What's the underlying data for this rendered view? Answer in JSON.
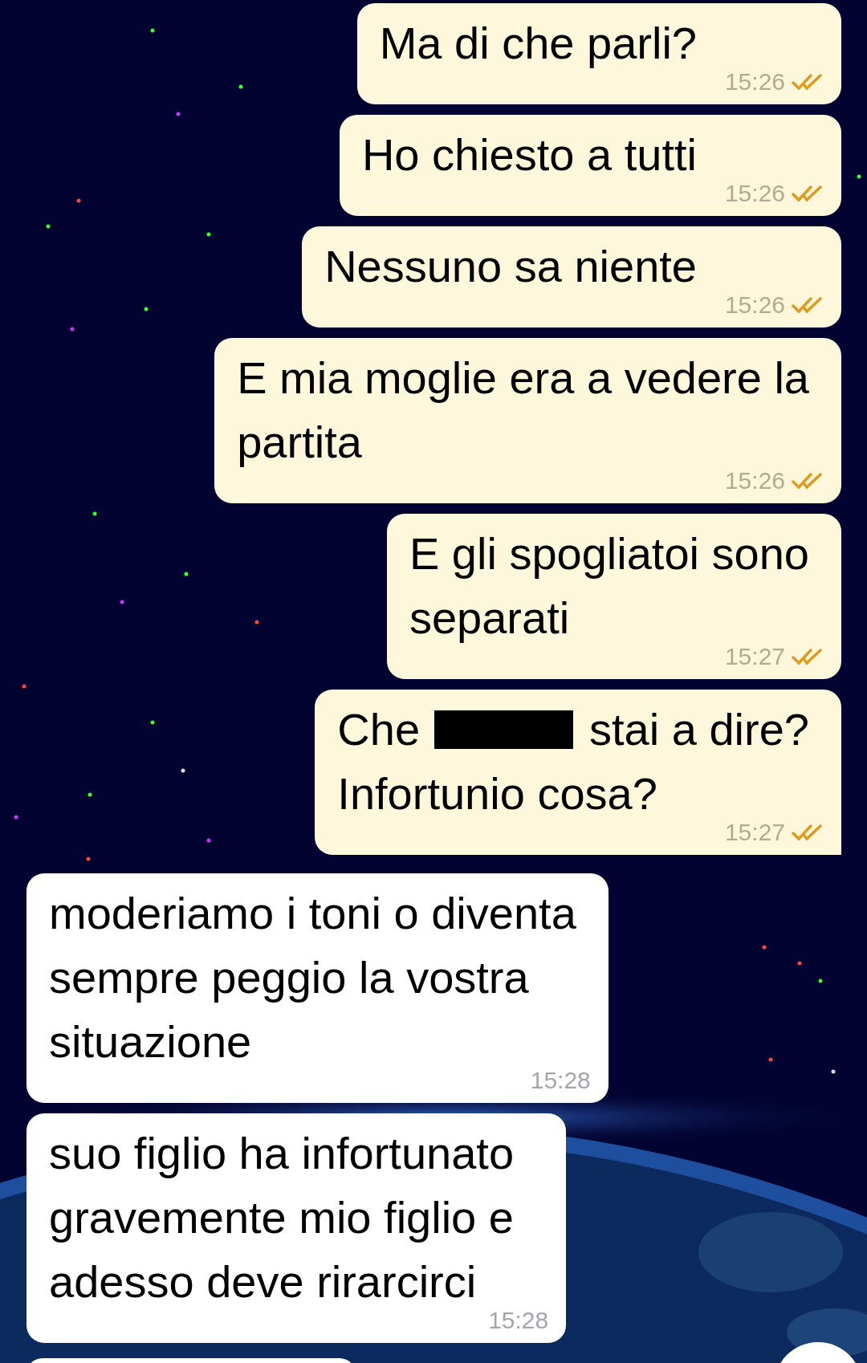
{
  "messages": [
    {
      "kind": "sent",
      "lines": [
        [
          {
            "kind": "text",
            "text": "Ma di che parli?"
          }
        ]
      ],
      "time": "15:26",
      "read": true,
      "tail": false
    },
    {
      "kind": "sent",
      "lines": [
        [
          {
            "kind": "text",
            "text": "Ho chiesto a tutti"
          }
        ]
      ],
      "time": "15:26",
      "read": true,
      "tail": false
    },
    {
      "kind": "sent",
      "lines": [
        [
          {
            "kind": "text",
            "text": "Nessuno sa niente"
          }
        ]
      ],
      "time": "15:26",
      "read": true,
      "tail": false
    },
    {
      "kind": "sent",
      "lines": [
        [
          {
            "kind": "text",
            "text": "E mia moglie era a vedere la"
          }
        ],
        [
          {
            "kind": "text",
            "text": "partita"
          }
        ]
      ],
      "time": "15:26",
      "read": true,
      "tail": false
    },
    {
      "kind": "sent",
      "lines": [
        [
          {
            "kind": "text",
            "text": "E gli spogliatoi sono"
          }
        ],
        [
          {
            "kind": "text",
            "text": "separati"
          }
        ]
      ],
      "time": "15:27",
      "read": true,
      "tail": false
    },
    {
      "kind": "sent",
      "lines": [
        [
          {
            "kind": "text",
            "text": "Che"
          },
          {
            "kind": "redaction"
          },
          {
            "kind": "text",
            "text": "stai a dire?"
          }
        ],
        [
          {
            "kind": "text",
            "text": "Infortunio cosa?"
          }
        ]
      ],
      "time": "15:27",
      "read": true,
      "tail": true
    },
    {
      "kind": "received",
      "lines": [
        [
          {
            "kind": "text",
            "text": "moderiamo i toni o diventa"
          }
        ],
        [
          {
            "kind": "text",
            "text": "sempre peggio la vostra"
          }
        ],
        [
          {
            "kind": "text",
            "text": "situazione"
          }
        ]
      ],
      "time": "15:28",
      "tail": false
    },
    {
      "kind": "received",
      "lines": [
        [
          {
            "kind": "text",
            "text": "suo figlio ha infortunato"
          }
        ],
        [
          {
            "kind": "text",
            "text": "gravemente mio figlio e"
          }
        ],
        [
          {
            "kind": "text",
            "text": "adesso deve rirarcirci"
          }
        ]
      ],
      "time": "15:28",
      "tail": false
    }
  ]
}
